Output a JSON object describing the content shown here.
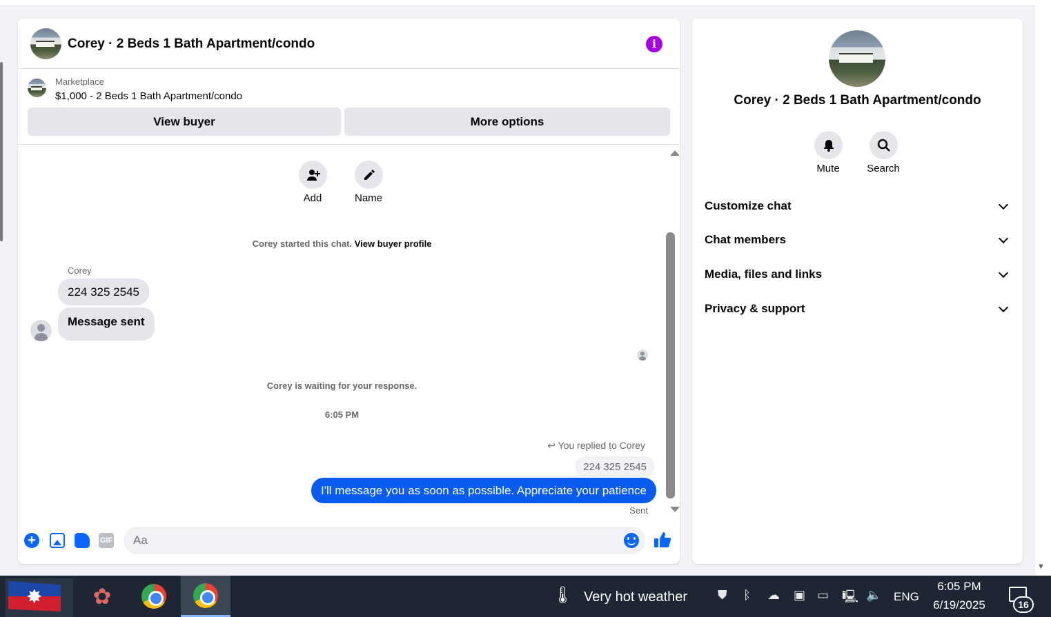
{
  "chat": {
    "title": "Corey · 2 Beds 1 Bath Apartment/condo",
    "marketplace_label": "Marketplace",
    "marketplace_item": "$1,000 - 2 Beds 1 Bath Apartment/condo",
    "view_buyer": "View buyer",
    "more_options": "More options",
    "add_label": "Add",
    "name_label": "Name",
    "started_text": "Corey started this chat.",
    "view_profile_link": "View buyer profile",
    "sender_name": "Corey",
    "messages": [
      "224 325 2545",
      "Message sent"
    ],
    "waiting_text": "Corey is waiting for your response.",
    "time_divider": "6:05 PM",
    "replied_label": "You replied to Corey",
    "reply_quote": "224 325 2545",
    "my_message": "I'll message you as soon as possible. Appreciate your patience",
    "sent_status": "Sent",
    "composer_placeholder": "Aa",
    "gif_label": "GIF",
    "accent_color": "#0866ff",
    "info_color": "#a400e0"
  },
  "side": {
    "title": "Corey · 2 Beds 1 Bath Apartment/condo",
    "mute": "Mute",
    "search": "Search",
    "sections": [
      "Customize chat",
      "Chat members",
      "Media, files and links",
      "Privacy & support"
    ]
  },
  "taskbar": {
    "weather": "Very hot weather",
    "lang": "ENG",
    "time": "6:05 PM",
    "date": "6/19/2025",
    "notifications": "16"
  }
}
